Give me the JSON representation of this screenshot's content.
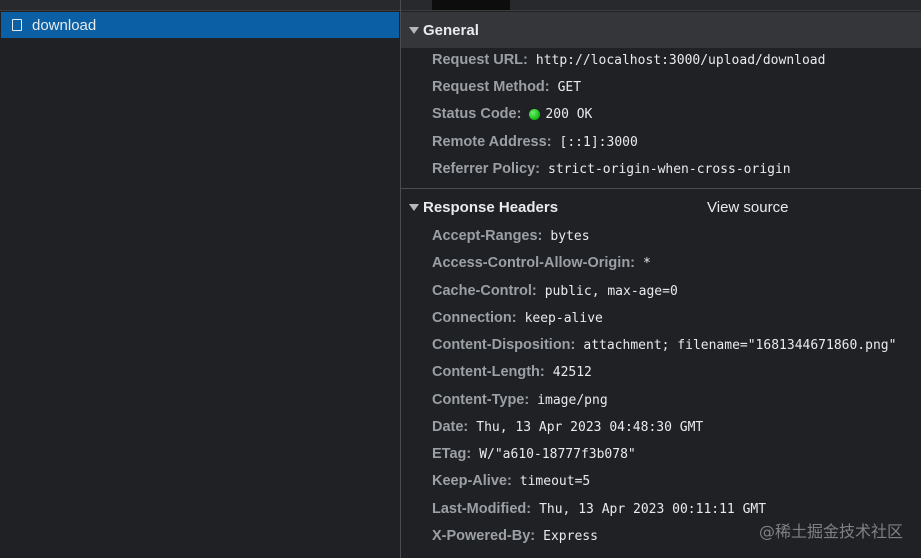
{
  "request_list": {
    "selected": "download"
  },
  "general": {
    "title": "General",
    "rows": [
      {
        "key": "Request URL:",
        "value": "http://localhost:3000/upload/download"
      },
      {
        "key": "Request Method:",
        "value": "GET"
      },
      {
        "key": "Status Code:",
        "value": "200 OK",
        "status_color": "#1ec41e"
      },
      {
        "key": "Remote Address:",
        "value": "[::1]:3000"
      },
      {
        "key": "Referrer Policy:",
        "value": "strict-origin-when-cross-origin"
      }
    ]
  },
  "response_headers": {
    "title": "Response Headers",
    "view_source": "View source",
    "rows": [
      {
        "key": "Accept-Ranges:",
        "value": "bytes"
      },
      {
        "key": "Access-Control-Allow-Origin:",
        "value": "*"
      },
      {
        "key": "Cache-Control:",
        "value": "public, max-age=0"
      },
      {
        "key": "Connection:",
        "value": "keep-alive"
      },
      {
        "key": "Content-Disposition:",
        "value": "attachment; filename=\"1681344671860.png\""
      },
      {
        "key": "Content-Length:",
        "value": "42512"
      },
      {
        "key": "Content-Type:",
        "value": "image/png"
      },
      {
        "key": "Date:",
        "value": "Thu, 13 Apr 2023 04:48:30 GMT"
      },
      {
        "key": "ETag:",
        "value": "W/\"a610-18777f3b078\""
      },
      {
        "key": "Keep-Alive:",
        "value": "timeout=5"
      },
      {
        "key": "Last-Modified:",
        "value": "Thu, 13 Apr 2023 00:11:11 GMT"
      },
      {
        "key": "X-Powered-By:",
        "value": "Express"
      }
    ]
  },
  "watermark": "@稀土掘金技术社区",
  "colors": {
    "selected_row": "#0b5fa4",
    "background": "#202124",
    "header_bg": "#35363a",
    "key_text": "#9aa0a6",
    "value_text": "#e8eaed"
  }
}
